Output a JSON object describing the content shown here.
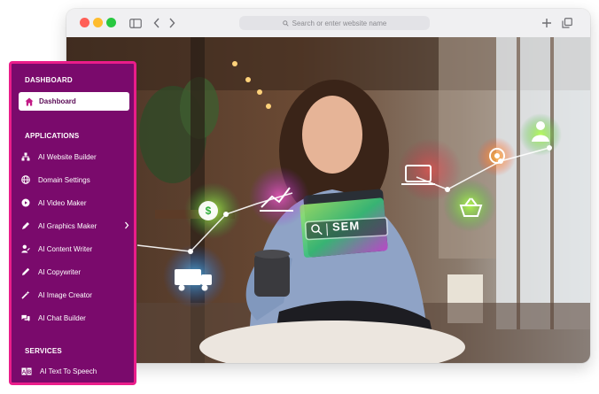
{
  "browser": {
    "address_placeholder": "Search or enter website name"
  },
  "scene": {
    "sem_label": "SEM"
  },
  "sidebar": {
    "dashboard_section": "DASHBOARD",
    "dashboard_item": "Dashboard",
    "applications_section": "APPLICATIONS",
    "applications": [
      {
        "label": "AI Website Builder",
        "icon": "sitemap-icon"
      },
      {
        "label": "Domain Settings",
        "icon": "globe-icon"
      },
      {
        "label": "AI Video Maker",
        "icon": "video-icon"
      },
      {
        "label": "AI Graphics Maker",
        "icon": "pen-icon"
      },
      {
        "label": "AI Content Writer",
        "icon": "user-edit-icon"
      },
      {
        "label": "AI Copywriter",
        "icon": "pencil-icon"
      },
      {
        "label": "AI Image Creator",
        "icon": "magic-icon"
      },
      {
        "label": "AI Chat Builder",
        "icon": "chat-icon"
      }
    ],
    "services_section": "SERVICES",
    "services": [
      {
        "label": "AI Text To Speech",
        "icon": "text-speech-icon"
      }
    ]
  },
  "colors": {
    "sidebar_bg": "#7a0a6c",
    "sidebar_border": "#ea1d8a",
    "active_text": "#5a0a55"
  }
}
